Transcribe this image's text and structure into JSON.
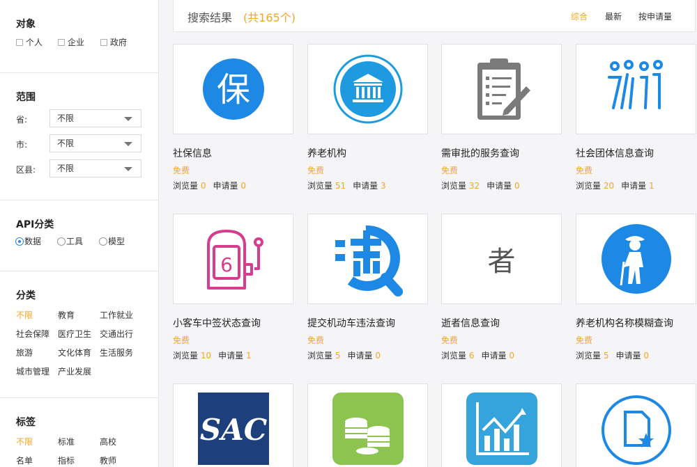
{
  "sidebar": {
    "object": {
      "title": "对象",
      "options": [
        "个人",
        "企业",
        "政府"
      ]
    },
    "scope": {
      "title": "范围",
      "province": {
        "label": "省:",
        "value": "不限"
      },
      "city": {
        "label": "市:",
        "value": "不限"
      },
      "district": {
        "label": "区县:",
        "value": "不限"
      }
    },
    "api_category": {
      "title": "API分类",
      "options": [
        "数据",
        "工具",
        "模型"
      ],
      "selected": "数据"
    },
    "category": {
      "title": "分类",
      "items": [
        "不限",
        "教育",
        "工作就业",
        "社会保障",
        "医疗卫生",
        "交通出行",
        "旅游",
        "文化体育",
        "生活服务",
        "城市管理",
        "产业发展"
      ],
      "active": "不限"
    },
    "tags": {
      "title": "标签",
      "items": [
        "不限",
        "标准",
        "高校",
        "名单",
        "指标",
        "教师"
      ],
      "active": "不限"
    }
  },
  "results": {
    "title": "搜索结果",
    "count_text": "(共165个)",
    "sort": [
      "综合",
      "最新",
      "按申请量"
    ],
    "sort_active": "综合",
    "views_label": "浏览量",
    "requests_label": "申请量"
  },
  "cards": [
    {
      "title": "社保信息",
      "price": "免费",
      "views": "0",
      "requests": "0",
      "icon": "bao-icon"
    },
    {
      "title": "养老机构",
      "price": "免费",
      "views": "51",
      "requests": "3",
      "icon": "bank-icon"
    },
    {
      "title": "需审批的服务查询",
      "price": "免费",
      "views": "32",
      "requests": "0",
      "icon": "clipboard-icon"
    },
    {
      "title": "社会团体信息查询",
      "price": "免费",
      "views": "20",
      "requests": "1",
      "icon": "people-icon"
    },
    {
      "title": "小客车中签状态查询",
      "price": "免费",
      "views": "10",
      "requests": "1",
      "icon": "slot-machine-icon"
    },
    {
      "title": "提交机动车违法查询",
      "price": "免费",
      "views": "5",
      "requests": "0",
      "icon": "violation-icon"
    },
    {
      "title": "逝者信息查询",
      "price": "免费",
      "views": "6",
      "requests": "0",
      "icon": "zhe-char-icon",
      "glyph": "者"
    },
    {
      "title": "养老机构名称模糊查询",
      "price": "免费",
      "views": "5",
      "requests": "0",
      "icon": "elderly-icon"
    },
    {
      "icon": "sac-logo-icon",
      "logo_text": "SAC"
    },
    {
      "icon": "coins-icon"
    },
    {
      "icon": "bar-chart-icon"
    },
    {
      "icon": "document-star-icon"
    }
  ],
  "colors": {
    "accent": "#f5a623",
    "blue": "#1e88e5",
    "pink": "#d63d8f"
  }
}
